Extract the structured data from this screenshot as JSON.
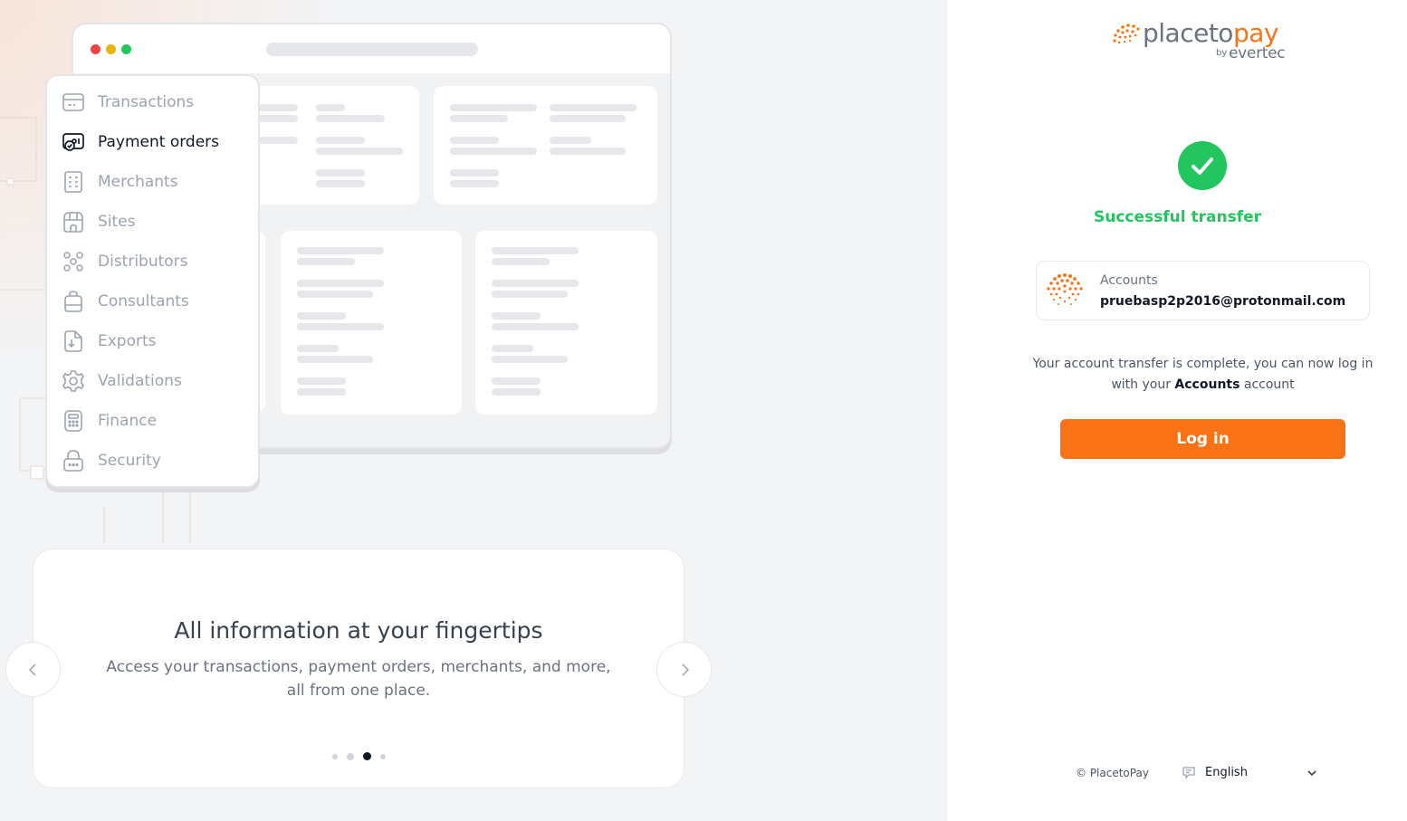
{
  "sidebar_menu": {
    "items": [
      {
        "label": "Transactions",
        "icon": "card-icon",
        "active": false
      },
      {
        "label": "Payment orders",
        "icon": "payment-orders-icon",
        "active": true
      },
      {
        "label": "Merchants",
        "icon": "merchants-icon",
        "active": false
      },
      {
        "label": "Sites",
        "icon": "store-icon",
        "active": false
      },
      {
        "label": "Distributors",
        "icon": "distributors-icon",
        "active": false
      },
      {
        "label": "Consultants",
        "icon": "briefcase-icon",
        "active": false
      },
      {
        "label": "Exports",
        "icon": "export-icon",
        "active": false
      },
      {
        "label": "Validations",
        "icon": "gear-icon",
        "active": false
      },
      {
        "label": "Finance",
        "icon": "calculator-icon",
        "active": false
      },
      {
        "label": "Security",
        "icon": "lock-icon",
        "active": false
      }
    ]
  },
  "carousel": {
    "title": "All information at your fingertips",
    "description": "Access your transactions, payment orders, merchants, and more, all from one place.",
    "active_slide": 3,
    "slide_count": 4
  },
  "brand": {
    "name_prefix": "placeto",
    "name_accent": "pay",
    "by": "by",
    "parent": "evertec",
    "accent_color": "#f97316",
    "success_color": "#22c55e"
  },
  "status": {
    "title": "Successful transfer"
  },
  "account": {
    "label": "Accounts",
    "email": "pruebasp2p2016@protonmail.com"
  },
  "message": {
    "part1": "Your account transfer is complete, you can now log in with your ",
    "bold": "Accounts",
    "part2": " account"
  },
  "actions": {
    "login_label": "Log in"
  },
  "footer": {
    "copyright": "© PlacetoPay",
    "language": "English"
  }
}
